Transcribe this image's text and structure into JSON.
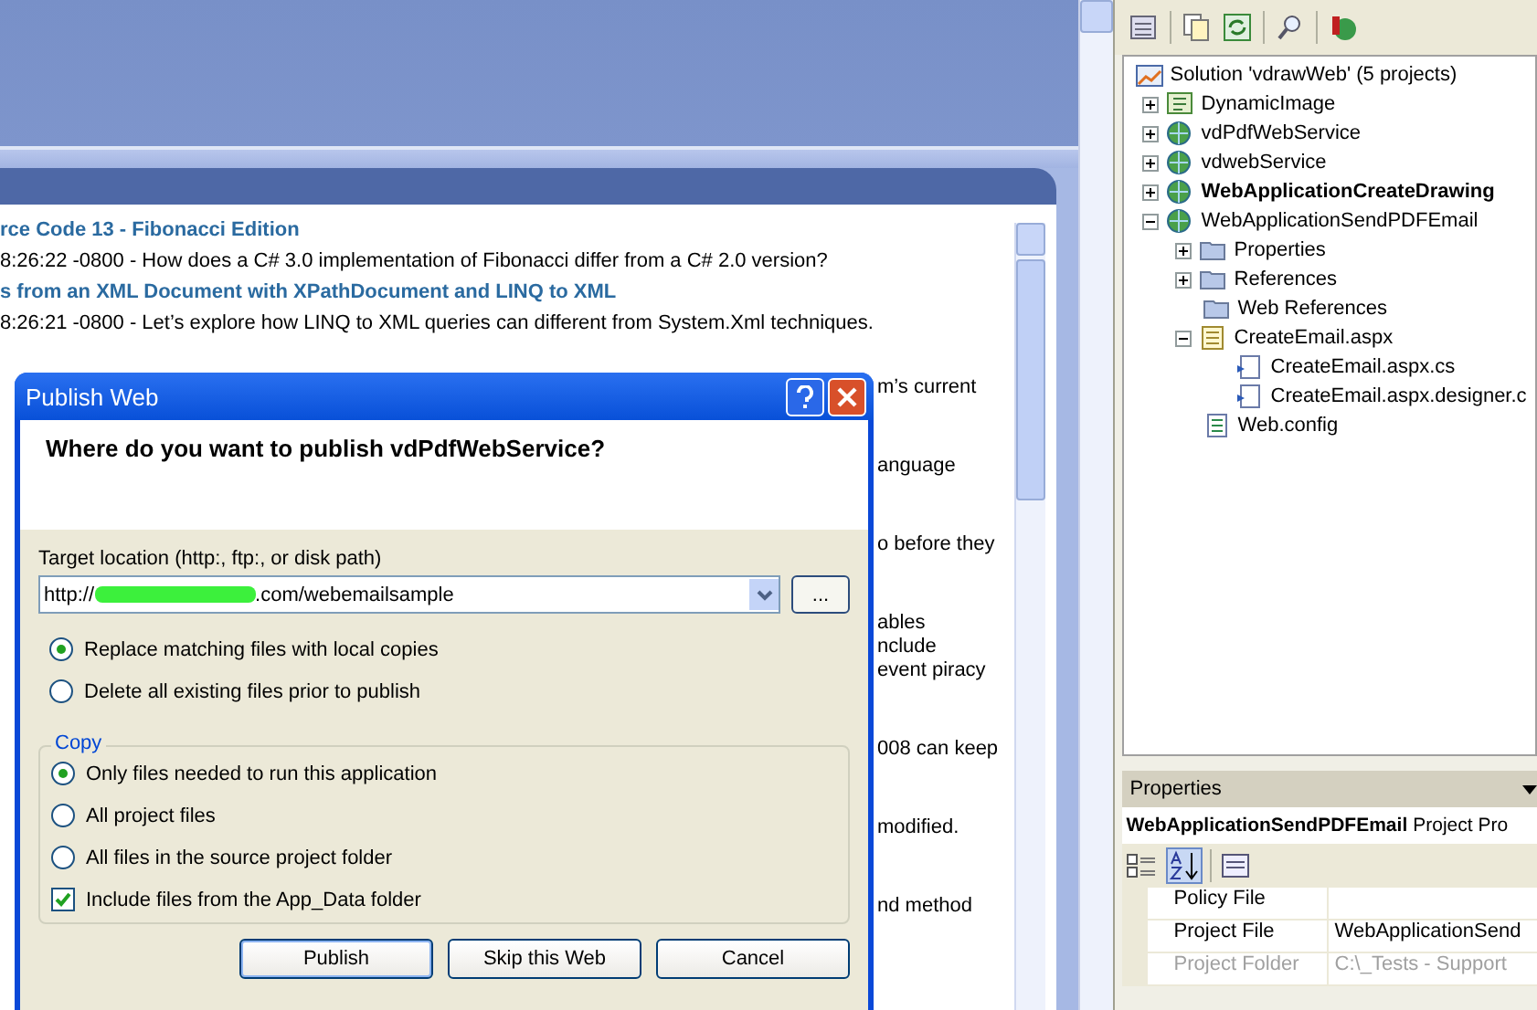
{
  "page": {
    "lines": [
      {
        "kind": "link",
        "text": "rce Code 13 - Fibonacci Edition"
      },
      {
        "kind": "text",
        "text": "8:26:22 -0800 - How does a C# 3.0 implementation of Fibonacci differ from a C# 2.0 version?"
      },
      {
        "kind": "link",
        "text": "s from an XML Document with XPathDocument and LINQ to XML"
      },
      {
        "kind": "text",
        "text": "8:26:21 -0800 - Let’s explore how LINQ to XML queries can different from System.Xml techniques."
      }
    ],
    "right_fragments": [
      [
        "m’s current"
      ],
      [
        "anguage"
      ],
      [
        "o before they"
      ],
      [
        "ables",
        "nclude",
        "event piracy"
      ],
      [
        "008 can keep"
      ],
      [
        "modified."
      ],
      [
        "nd method"
      ]
    ]
  },
  "dialog": {
    "title": "Publish Web",
    "heading": "Where do you want to publish vdPdfWebService?",
    "target_label": "Target location (http:, ftp:, or disk path)",
    "target_value_start": "http://",
    "target_value_end": ".com/webemailsample",
    "browse_button": "...",
    "mode_options": [
      {
        "label": "Replace matching files with local copies",
        "selected": true
      },
      {
        "label": "Delete all existing files prior to publish",
        "selected": false
      }
    ],
    "copy_group": {
      "title": "Copy",
      "options": [
        {
          "label": "Only files needed to run this application",
          "selected": true
        },
        {
          "label": "All project files",
          "selected": false
        },
        {
          "label": "All files in the source project folder",
          "selected": false
        }
      ],
      "include_app_data": {
        "label": "Include files from the App_Data folder",
        "checked": true
      }
    },
    "buttons": [
      "Publish",
      "Skip this Web",
      "Cancel"
    ]
  },
  "solution_explorer": {
    "root": "Solution 'vdrawWeb' (5 projects)",
    "items": [
      {
        "label": "DynamicImage",
        "kind": "project",
        "expanded": false,
        "bold": false
      },
      {
        "label": "vdPdfWebService",
        "kind": "web",
        "expanded": false,
        "bold": false
      },
      {
        "label": "vdwebService",
        "kind": "web",
        "expanded": false,
        "bold": false
      },
      {
        "label": "WebApplicationCreateDrawing",
        "kind": "web",
        "expanded": false,
        "bold": true
      },
      {
        "label": "WebApplicationSendPDFEmail",
        "kind": "web",
        "expanded": true,
        "bold": false,
        "children": [
          {
            "label": "Properties",
            "kind": "folder",
            "expanded": false,
            "bold": false
          },
          {
            "label": "References",
            "kind": "folder",
            "expanded": false,
            "bold": false
          },
          {
            "label": "Web References",
            "kind": "folder",
            "bold": false
          },
          {
            "label": "CreateEmail.aspx",
            "kind": "page",
            "expanded": true,
            "bold": false,
            "children": [
              {
                "label": "CreateEmail.aspx.cs",
                "kind": "code",
                "bold": false
              },
              {
                "label": "CreateEmail.aspx.designer.c",
                "kind": "code",
                "bold": false
              }
            ]
          },
          {
            "label": "Web.config",
            "kind": "config",
            "bold": false
          }
        ]
      }
    ]
  },
  "properties": {
    "title": "Properties",
    "object_name": "WebApplicationSendPDFEmail",
    "object_type": "Project Pro",
    "rows": [
      {
        "name": "Policy File",
        "disabled": false
      },
      {
        "name": "Project File",
        "value": "WebApplicationSend",
        "disabled": false
      },
      {
        "name": "Project Folder",
        "value": "C:\\_Tests - Support",
        "disabled": true
      }
    ]
  }
}
